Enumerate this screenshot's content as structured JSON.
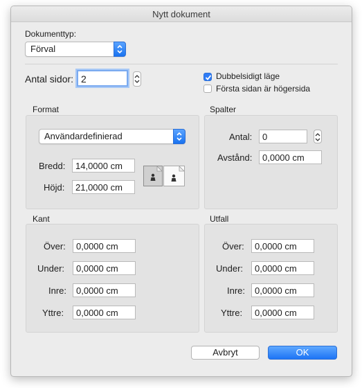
{
  "dialog": {
    "title": "Nytt dokument"
  },
  "doc_type": {
    "label": "Dokumenttyp:",
    "value": "Förval"
  },
  "pages": {
    "label": "Antal sidor:",
    "value": "2",
    "double_sided_label": "Dubbelsidigt läge",
    "double_sided_checked": true,
    "first_right_label": "Första sidan är högersida",
    "first_right_checked": false
  },
  "format": {
    "heading": "Format",
    "preset": "Användardefinierad",
    "width_label": "Bredd:",
    "width_value": "14,0000 cm",
    "height_label": "Höjd:",
    "height_value": "21,0000 cm",
    "orientation_icons": [
      "portrait-orientation-icon",
      "landscape-orientation-icon"
    ]
  },
  "columns": {
    "heading": "Spalter",
    "count_label": "Antal:",
    "count_value": "0",
    "gap_label": "Avstånd:",
    "gap_value": "0,0000 cm"
  },
  "margins": {
    "heading": "Kant",
    "top_label": "Över:",
    "top_value": "0,0000 cm",
    "bottom_label": "Under:",
    "bottom_value": "0,0000 cm",
    "inner_label": "Inre:",
    "inner_value": "0,0000 cm",
    "outer_label": "Yttre:",
    "outer_value": "0,0000 cm"
  },
  "bleed": {
    "heading": "Utfall",
    "top_label": "Över:",
    "top_value": "0,0000 cm",
    "bottom_label": "Under:",
    "bottom_value": "0,0000 cm",
    "inner_label": "Inre:",
    "inner_value": "0,0000 cm",
    "outer_label": "Yttre:",
    "outer_value": "0,0000 cm"
  },
  "buttons": {
    "cancel": "Avbryt",
    "ok": "OK"
  },
  "colors": {
    "accent": "#2f7cf6",
    "panel": "#e3e3e3",
    "window": "#ececec"
  }
}
